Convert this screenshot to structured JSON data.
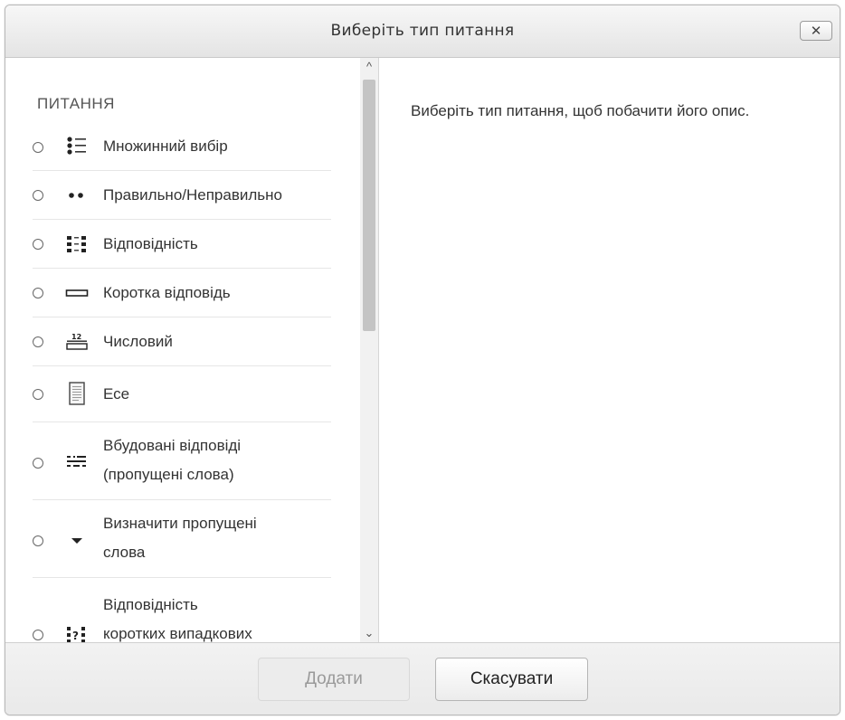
{
  "dialog": {
    "title": "Виберіть тип питання",
    "close_label": "✕"
  },
  "options": {
    "heading": "ПИТАННЯ",
    "items": [
      {
        "label": "Множинний вибір",
        "icon": "multiple-choice-icon"
      },
      {
        "label": "Правильно/Неправильно",
        "icon": "true-false-icon"
      },
      {
        "label": "Відповідність",
        "icon": "matching-icon"
      },
      {
        "label": "Коротка відповідь",
        "icon": "short-answer-icon"
      },
      {
        "label": "Числовий",
        "icon": "numerical-icon"
      },
      {
        "label": "Есе",
        "icon": "essay-icon"
      },
      {
        "label_line1": "Вбудовані відповіді",
        "label_line2": "(пропущені слова)",
        "icon": "embedded-answers-icon"
      },
      {
        "label_line1": "Визначити пропущені",
        "label_line2": "слова",
        "icon": "select-missing-words-icon"
      },
      {
        "label_line1": "Відповідність",
        "label_line2": "коротких випадкових",
        "icon": "random-short-answer-matching-icon"
      }
    ]
  },
  "scrollbar": {
    "up_arrow": "^",
    "down_arrow": "⌄"
  },
  "description": {
    "text": "Виберіть тип питання, щоб побачити його опис."
  },
  "footer": {
    "add_label": "Додати",
    "cancel_label": "Скасувати"
  }
}
